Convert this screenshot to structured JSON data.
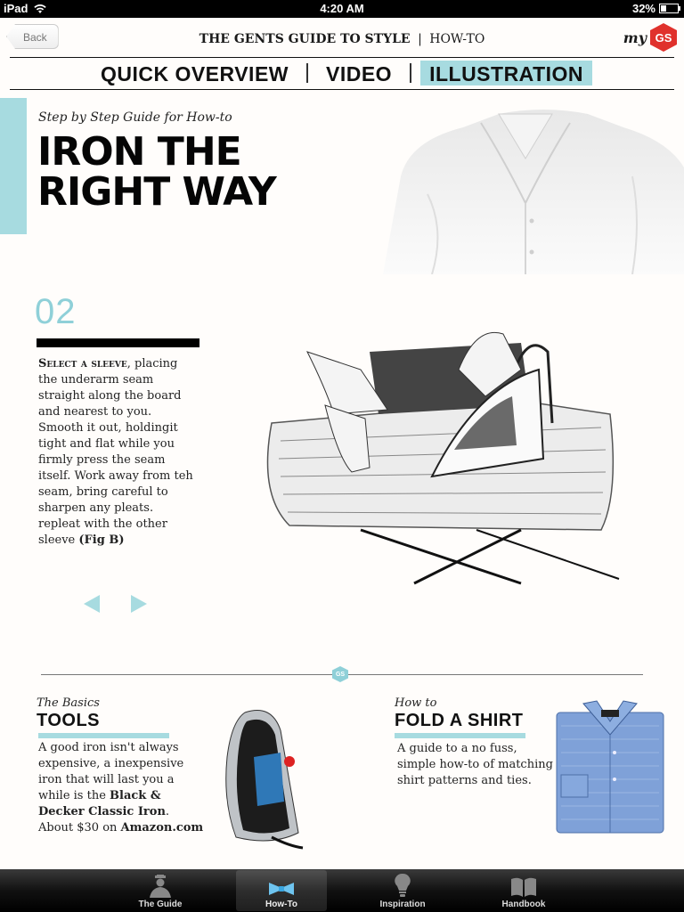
{
  "status_bar": {
    "device": "iPad",
    "time": "4:20 AM",
    "battery": "32%",
    "battery_level": 0.32
  },
  "header": {
    "back_label": "Back",
    "title_bold": "THE GENTS GUIDE TO STYLE",
    "title_separator": "|",
    "title_section": "HOW-TO",
    "logo_prefix": "my",
    "logo_badge": "GS"
  },
  "tabs": [
    {
      "label": "QUICK OVERVIEW",
      "active": false
    },
    {
      "label": "VIDEO",
      "active": false
    },
    {
      "label": "ILLUSTRATION",
      "active": true
    }
  ],
  "hero": {
    "kicker": "Step by Step Guide for How-to",
    "title_line1": "IRON THE",
    "title_line2": "RIGHT WAY"
  },
  "step": {
    "number": "02",
    "lead": "Select a sleeve",
    "body": ", placing the underarm seam straight along the board and nearest to you. Smooth it out, holdingit tight and flat while you firmly press the seam itself. Work away from teh seam, bring careful to sharpen any pleats. repleat with the other sleeve ",
    "fig": "(Fig B)"
  },
  "divider_badge": "GS",
  "tools_card": {
    "kicker": "The Basics",
    "title": "TOOLS",
    "body_1": "A good iron isn't always expensive, a inexpensive iron that will last you a while is the ",
    "product": "Black & Decker Classic Iron",
    "body_2": ". About $30 on ",
    "store": "Amazon.com"
  },
  "fold_card": {
    "kicker": "How to",
    "title": "FOLD A SHIRT",
    "body": "A guide to a no fuss, simple how-to of matching shirt patterns and ties."
  },
  "tab_bar": [
    {
      "label": "The Guide",
      "icon": "gentleman-icon",
      "active": false
    },
    {
      "label": "How-To",
      "icon": "bowtie-icon",
      "active": true
    },
    {
      "label": "Inspiration",
      "icon": "lightbulb-icon",
      "active": false
    },
    {
      "label": "Handbook",
      "icon": "book-icon",
      "active": false
    }
  ],
  "colors": {
    "accent": "#a7dbe0",
    "accent_dark": "#8fd0d8",
    "logo_red": "#e0312c"
  }
}
